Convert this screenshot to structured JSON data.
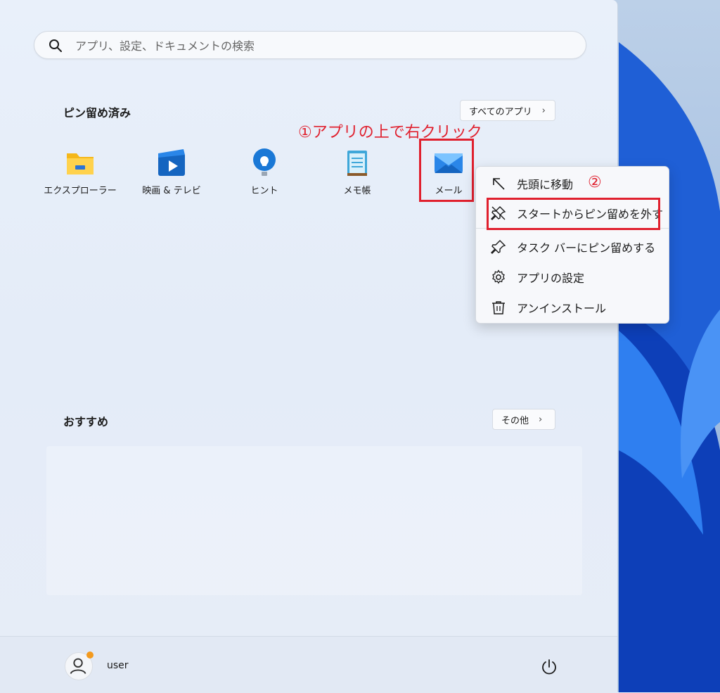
{
  "search": {
    "placeholder": "アプリ、設定、ドキュメントの検索"
  },
  "pinned": {
    "title": "ピン留め済み",
    "all_apps_label": "すべてのアプリ",
    "apps": [
      {
        "label": "エクスプローラー",
        "icon": "folder-icon"
      },
      {
        "label": "映画 & テレビ",
        "icon": "movies-tv-icon"
      },
      {
        "label": "ヒント",
        "icon": "lightbulb-icon"
      },
      {
        "label": "メモ帳",
        "icon": "notepad-icon"
      },
      {
        "label": "メール",
        "icon": "mail-icon"
      }
    ]
  },
  "annotations": {
    "step1": "①アプリの上で右クリック",
    "step2": "②"
  },
  "context_menu": {
    "items": [
      {
        "label": "先頭に移動",
        "icon": "arrow-up-left-icon"
      },
      {
        "label": "スタートからピン留めを外す",
        "icon": "unpin-icon"
      },
      {
        "label": "タスク バーにピン留めする",
        "icon": "pin-icon"
      },
      {
        "label": "アプリの設定",
        "icon": "gear-icon"
      },
      {
        "label": "アンインストール",
        "icon": "trash-icon"
      }
    ]
  },
  "recommended": {
    "title": "おすすめ",
    "more_label": "その他"
  },
  "footer": {
    "username": "user"
  },
  "colors": {
    "accent": "#0067c0",
    "annotation": "#e0202e",
    "badge": "#f39a1e"
  }
}
